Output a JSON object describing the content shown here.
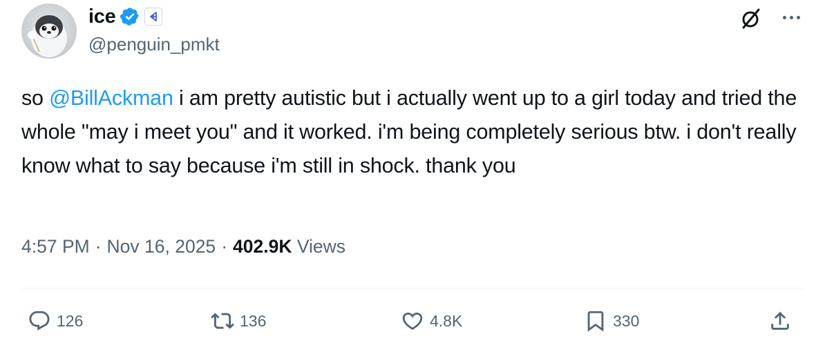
{
  "user": {
    "name": "ice",
    "handle": "@penguin_pmkt"
  },
  "tweet": {
    "prefix": "so ",
    "mention": "@BillAckman",
    "body": " i am pretty autistic but i actually went up to a girl today and tried the whole \"may i meet you\" and it worked. i'm being completely serious btw. i don't really know what to say because i'm still in shock. thank you"
  },
  "meta": {
    "time": "4:57 PM",
    "sep1": "·",
    "date": "Nov 16, 2025",
    "sep2": "·",
    "views_count": "402.9K",
    "views_label": "Views"
  },
  "actions": {
    "replies": "126",
    "reposts": "136",
    "likes": "4.8K",
    "bookmarks": "330"
  },
  "colors": {
    "accent": "#1d9bf0",
    "text": "#0f1419",
    "secondary": "#536471"
  }
}
